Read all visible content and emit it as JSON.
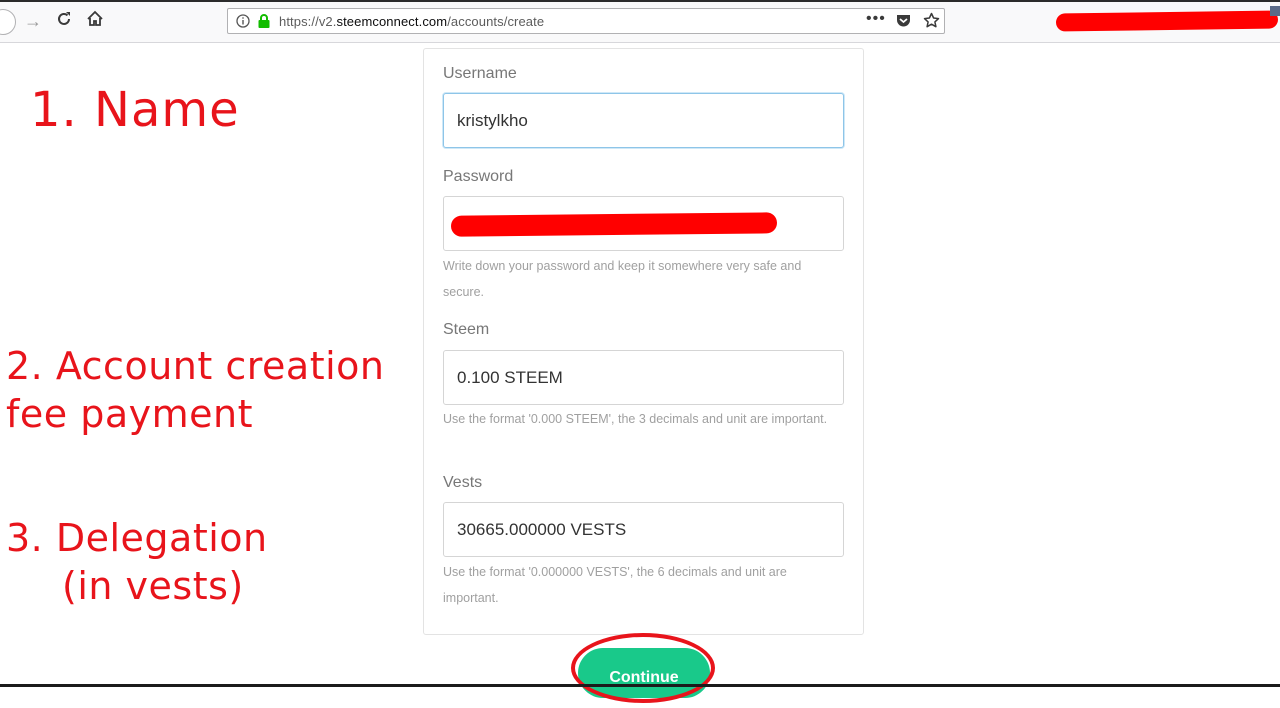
{
  "browser": {
    "url_prefix": "https://v2.",
    "url_domain": "steemconnect.com",
    "url_path": "/accounts/create"
  },
  "annotations": {
    "step1": "1. Name",
    "step2_line1": "2. Account creation",
    "step2_line2": "fee payment",
    "step3_line1": "3. Delegation",
    "step3_line2": "(in vests)"
  },
  "form": {
    "username_label": "Username",
    "username_value": "kristylkho",
    "password_label": "Password",
    "password_help": "Write down your password and keep it somewhere very safe and secure.",
    "steem_label": "Steem",
    "steem_value": "0.100 STEEM",
    "steem_help": "Use the format '0.000 STEEM', the 3 decimals and unit are important.",
    "vests_label": "Vests",
    "vests_value": "30665.000000 VESTS",
    "vests_help": "Use the format '0.000000 VESTS', the 6 decimals and unit are important.",
    "continue_label": "Continue"
  },
  "colors": {
    "annotation": "#e8141b",
    "button": "#19c98a"
  }
}
